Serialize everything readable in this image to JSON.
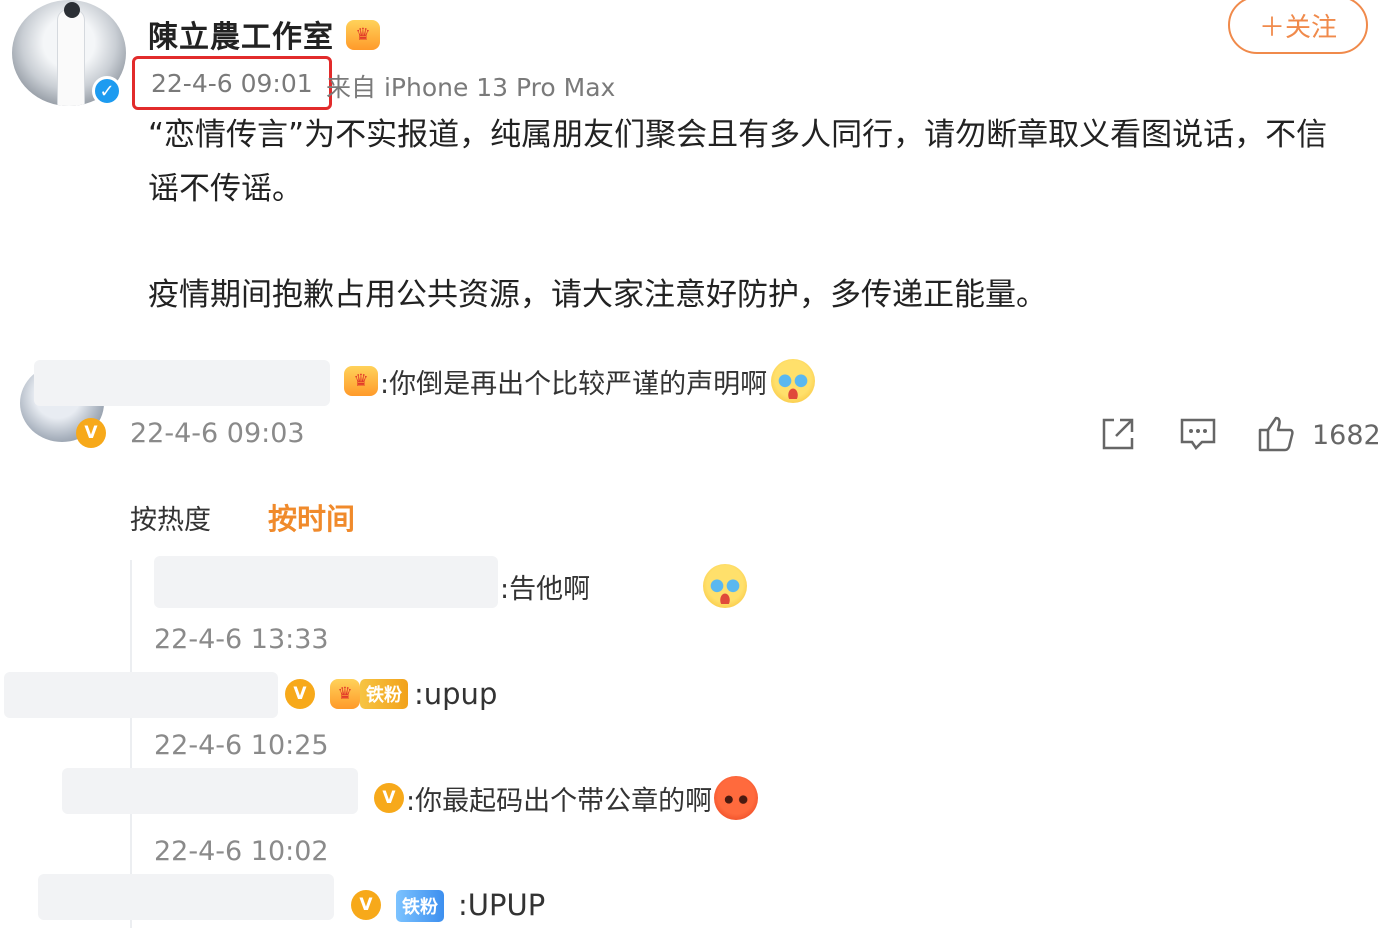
{
  "post": {
    "author": "陳立農工作室",
    "follow_label": "＋关注",
    "timestamp": "22-4-6 09:01",
    "source": "来自 iPhone 13 Pro Max",
    "text_line1": "“恋情传言”为不实报道，纯属朋友们聚会且有多人同行，请勿断章取义看图说话，不信",
    "text_line2": "谣不传谣。",
    "text_line3": "疫情期间抱歉占用公共资源，请大家注意好防护，多传递正能量。"
  },
  "top_comment": {
    "text": ":你倒是再出个比较严谨的声明啊",
    "timestamp": "22-4-6 09:03",
    "like_count": "1682"
  },
  "sort_tabs": {
    "hot": "按热度",
    "time": "按时间"
  },
  "replies": [
    {
      "text": ":告他啊",
      "timestamp": "22-4-6 13:33"
    },
    {
      "text": ":upup",
      "badge": "铁粉",
      "timestamp": "22-4-6 10:25"
    },
    {
      "text": ":你最起码出个带公章的啊",
      "timestamp": "22-4-6 10:02"
    },
    {
      "text": ":UPUP",
      "badge": "铁粉"
    }
  ],
  "icons": {
    "verified": "verified-badge-icon",
    "share": "share-icon",
    "comment": "comment-icon",
    "like": "like-icon"
  },
  "colors": {
    "accent": "#f08a2b",
    "highlight_box": "#e22b2b",
    "verified": "#1d9bf0"
  }
}
